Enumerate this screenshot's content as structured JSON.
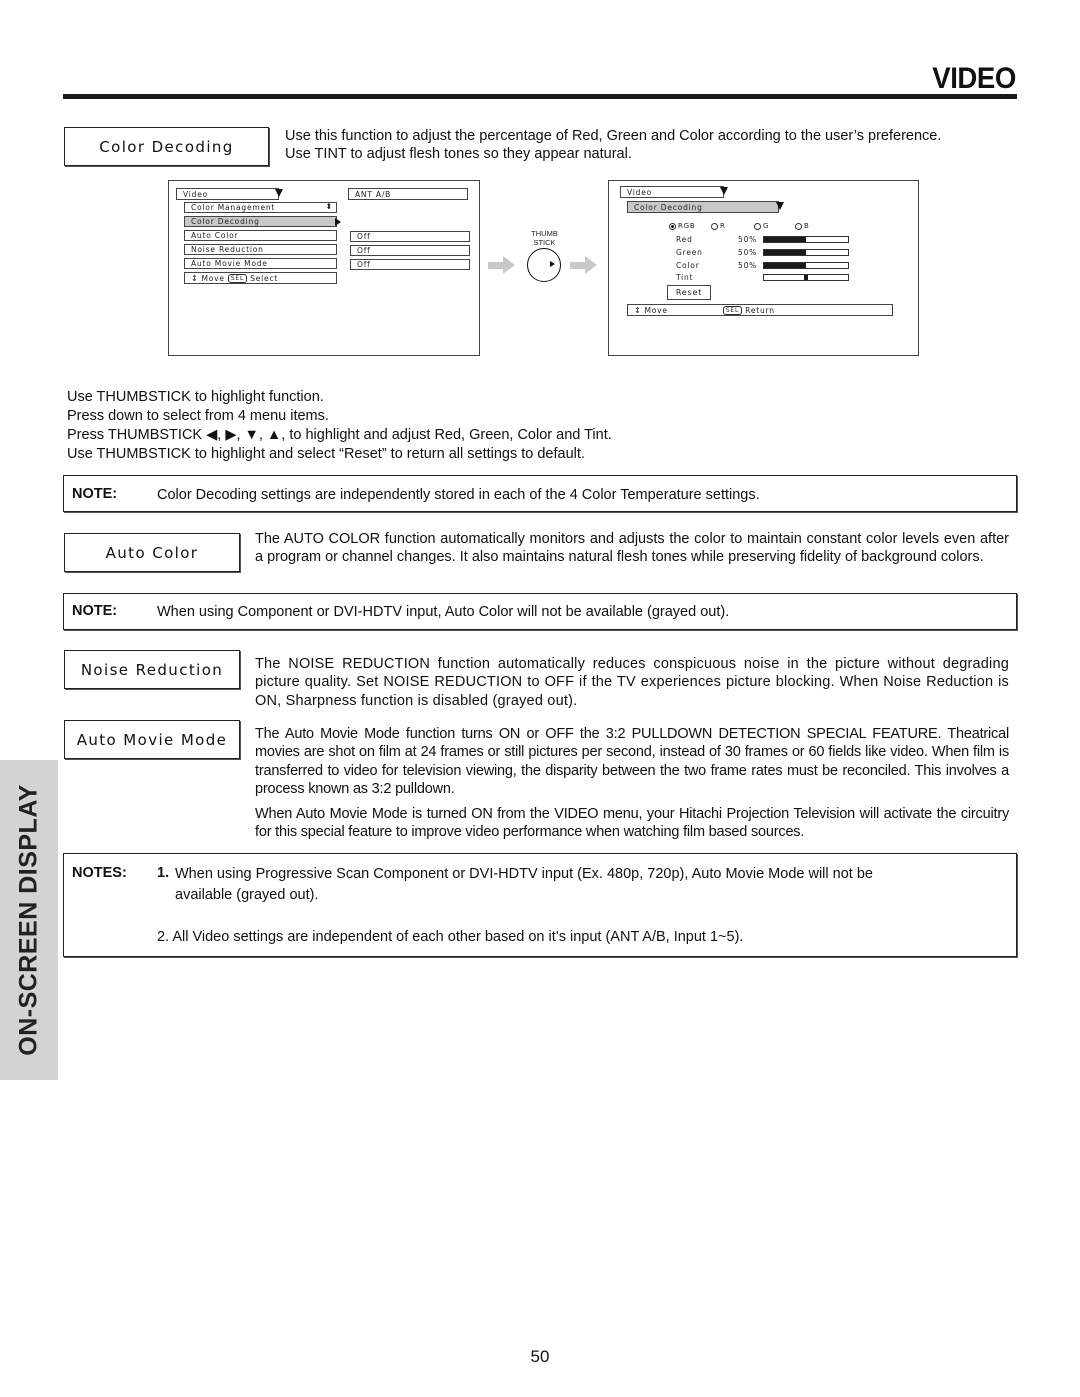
{
  "header": {
    "title": "VIDEO"
  },
  "side_tab": {
    "label": "ON-SCREEN DISPLAY"
  },
  "sections": {
    "color_decoding": {
      "label": "Color Decoding",
      "description": [
        "Use this function to adjust the percentage of Red, Green and Color according to the user’s preference.",
        "Use TINT to adjust flesh tones so they appear natural."
      ]
    },
    "auto_color": {
      "label": "Auto Color",
      "description": "The AUTO COLOR function automatically monitors and adjusts the color to maintain constant color levels even after a program or channel changes. It also maintains natural flesh tones while preserving fidelity of background colors."
    },
    "noise_reduction": {
      "label": "Noise Reduction",
      "description": "The NOISE REDUCTION function automatically reduces conspicuous noise in the picture without degrading picture quality.  Set NOISE REDUCTION to OFF if the TV experiences picture blocking. When Noise Reduction is ON, Sharpness function is disabled (grayed out)."
    },
    "auto_movie_mode": {
      "label": "Auto Movie Mode",
      "description": "The Auto Movie Mode function turns ON or OFF the 3:2 PULLDOWN DETECTION SPECIAL FEATURE. Theatrical movies are shot on film at 24 frames or still pictures per second, instead of 30 frames or 60 fields like video.  When film is transferred to video for television viewing, the disparity between the two frame rates must be reconciled.  This involves a process known as 3:2 pulldown.",
      "description2": "When Auto Movie Mode is turned ON from the VIDEO menu, your Hitachi Projection Television will activate the circuitry for this special feature to improve video performance when watching film based sources."
    }
  },
  "osd_menu_left": {
    "title": "Video",
    "input": "ANT A/B",
    "items": [
      {
        "label": "Color Management",
        "value": ""
      },
      {
        "label": "Color Decoding",
        "value": "",
        "highlighted": true
      },
      {
        "label": "Auto Color",
        "value": "Off"
      },
      {
        "label": "Noise Reduction",
        "value": "Off"
      },
      {
        "label": "Auto Movie Mode",
        "value": "Off"
      }
    ],
    "footer": {
      "move": "Move",
      "sel": "SEL",
      "action": "Select"
    }
  },
  "thumbstick": {
    "label_line1": "THUMB",
    "label_line2": "STICK"
  },
  "osd_menu_right": {
    "title": "Video",
    "submenu": "Color Decoding",
    "modes": [
      {
        "label": "RGB",
        "selected": true
      },
      {
        "label": "R",
        "selected": false
      },
      {
        "label": "G",
        "selected": false
      },
      {
        "label": "B",
        "selected": false
      }
    ],
    "sliders": [
      {
        "label": "Red",
        "value_text": "50%",
        "value": 0.5
      },
      {
        "label": "Green",
        "value_text": "50%",
        "value": 0.5
      },
      {
        "label": "Color",
        "value_text": "50%",
        "value": 0.5
      },
      {
        "label": "Tint",
        "value_text": "",
        "value": 0.5
      }
    ],
    "reset_label": "Reset",
    "footer": {
      "move": "Move",
      "sel": "SEL",
      "action": "Return"
    }
  },
  "instructions": [
    "Use THUMBSTICK to highlight function.",
    "Press down to select from 4 menu items.",
    "Press THUMBSTICK ◀, ▶, ▼, ▲, to highlight and adjust Red, Green, Color and Tint.",
    "Use THUMBSTICK to highlight and select “Reset” to return all settings to default."
  ],
  "notes": {
    "color_decoding": {
      "label": "NOTE:",
      "text": "Color Decoding settings are independently stored in each of the 4 Color Temperature settings."
    },
    "auto_color": {
      "label": "NOTE:",
      "text": "When using Component or DVI-HDTV input, Auto Color will not be available (grayed out)."
    },
    "final": {
      "label": "NOTES:",
      "item1_num": "1.",
      "item1_text": "When using Progressive Scan Component or DVI-HDTV input (Ex. 480p, 720p), Auto Movie Mode will not be",
      "item1_cont": "available (grayed out).",
      "item2": "2. All Video settings are independent of each other based on it’s input (ANT A/B, Input 1~5)."
    }
  },
  "page_number": "50"
}
